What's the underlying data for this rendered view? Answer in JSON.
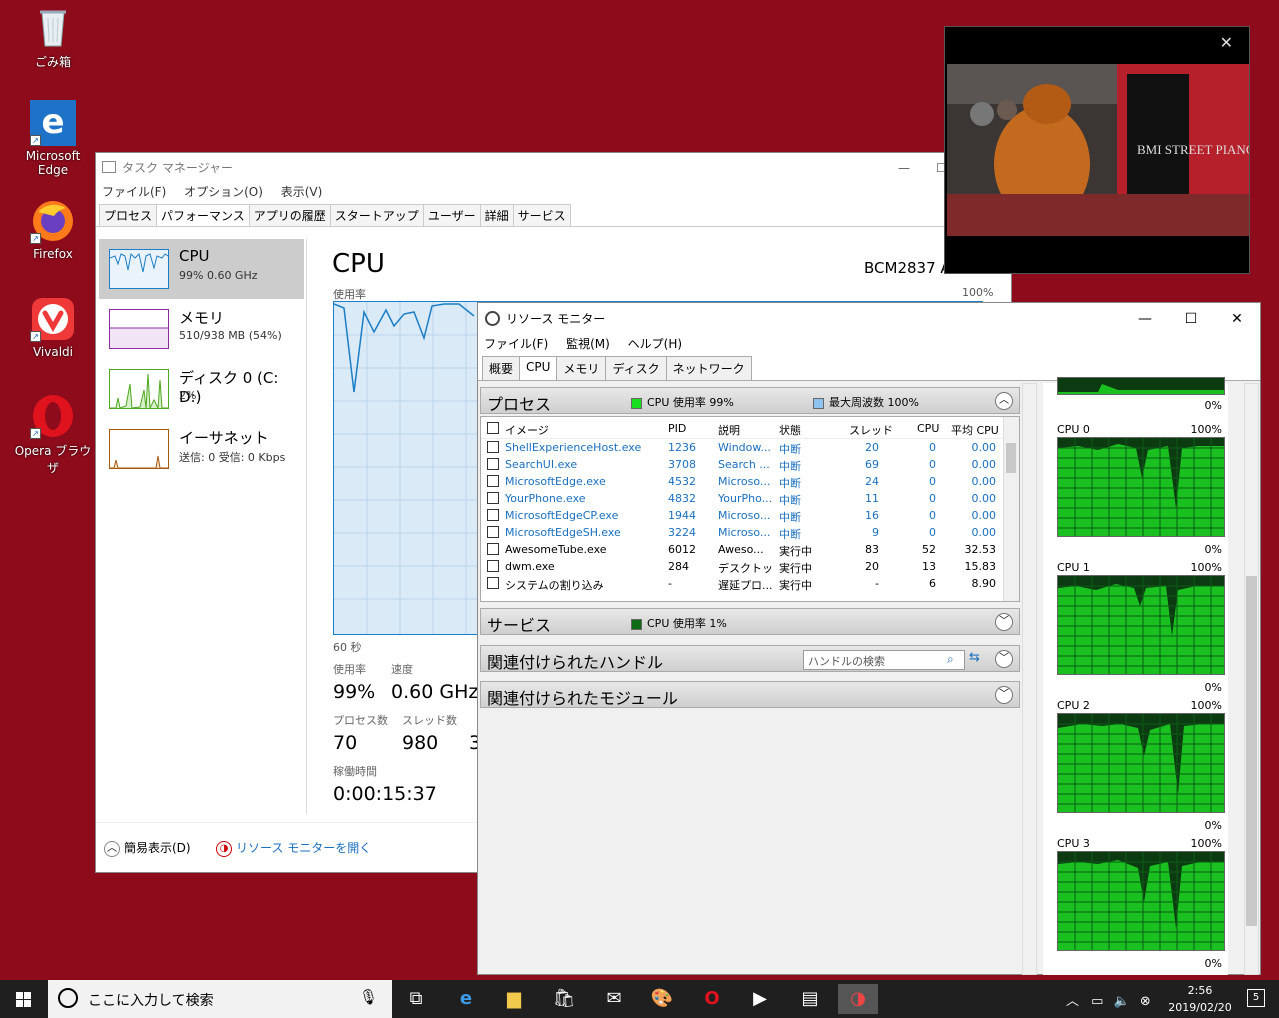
{
  "desktop": {
    "icons": [
      {
        "label": "ごみ箱",
        "icon": "recycle-bin-icon"
      },
      {
        "label": "Microsoft Edge",
        "icon": "edge-icon"
      },
      {
        "label": "Firefox",
        "icon": "firefox-icon"
      },
      {
        "label": "Vivaldi",
        "icon": "vivaldi-icon"
      },
      {
        "label": "Opera ブラウザ",
        "icon": "opera-icon"
      }
    ]
  },
  "task_manager": {
    "title": "タスク マネージャー",
    "menu": [
      "ファイル(F)",
      "オプション(O)",
      "表示(V)"
    ],
    "tabs": [
      "プロセス",
      "パフォーマンス",
      "アプリの履歴",
      "スタートアップ",
      "ユーザー",
      "詳細",
      "サービス"
    ],
    "active_tab": "パフォーマンス",
    "side": [
      {
        "name": "CPU",
        "sub": "99%  0.60 GHz"
      },
      {
        "name": "メモリ",
        "sub": "510/938 MB (54%)"
      },
      {
        "name": "ディスク 0 (C: D:)",
        "sub": "2%"
      },
      {
        "name": "イーサネット",
        "sub": "送信: 0 受信: 0 Kbps"
      }
    ],
    "header": "CPU",
    "model": "BCM2837 A",
    "usage_label": "使用率",
    "pct_label": "100%",
    "time_label": "60 秒",
    "stats": {
      "usage_label": "使用率",
      "usage_value": "99%",
      "speed_label": "速度",
      "speed_value": "0.60 GHz",
      "proc_label": "プロセス数",
      "proc_value": "70",
      "thread_label": "スレッド数",
      "thread_value": "980",
      "handle_value": "3",
      "uptime_label": "稼働時間",
      "uptime_value": "0:00:15:37"
    },
    "footer": {
      "simple": "簡易表示(D)",
      "resmon": "リソース モニターを開く"
    }
  },
  "resource_monitor": {
    "title": "リソース モニター",
    "menu": [
      "ファイル(F)",
      "監視(M)",
      "ヘルプ(H)"
    ],
    "tabs": [
      "概要",
      "CPU",
      "メモリ",
      "ディスク",
      "ネットワーク"
    ],
    "active_tab": "CPU",
    "process_section": {
      "label": "プロセス",
      "cpu_legend": "CPU 使用率 99%",
      "freq_legend": "最大周波数 100%",
      "columns": [
        "イメージ",
        "PID",
        "説明",
        "状態",
        "スレッド",
        "CPU",
        "平均 CPU"
      ],
      "rows": [
        {
          "image": "ShellExperienceHost.exe",
          "pid": "1236",
          "desc": "Window...",
          "state": "中断",
          "threads": "20",
          "cpu": "0",
          "avg": "0.00",
          "suspended": true
        },
        {
          "image": "SearchUI.exe",
          "pid": "3708",
          "desc": "Search ...",
          "state": "中断",
          "threads": "69",
          "cpu": "0",
          "avg": "0.00",
          "suspended": true
        },
        {
          "image": "MicrosoftEdge.exe",
          "pid": "4532",
          "desc": "Microso...",
          "state": "中断",
          "threads": "24",
          "cpu": "0",
          "avg": "0.00",
          "suspended": true
        },
        {
          "image": "YourPhone.exe",
          "pid": "4832",
          "desc": "YourPho...",
          "state": "中断",
          "threads": "11",
          "cpu": "0",
          "avg": "0.00",
          "suspended": true
        },
        {
          "image": "MicrosoftEdgeCP.exe",
          "pid": "1944",
          "desc": "Microso...",
          "state": "中断",
          "threads": "16",
          "cpu": "0",
          "avg": "0.00",
          "suspended": true
        },
        {
          "image": "MicrosoftEdgeSH.exe",
          "pid": "3224",
          "desc": "Microso...",
          "state": "中断",
          "threads": "9",
          "cpu": "0",
          "avg": "0.00",
          "suspended": true
        },
        {
          "image": "AwesomeTube.exe",
          "pid": "6012",
          "desc": "Aweso...",
          "state": "実行中",
          "threads": "83",
          "cpu": "52",
          "avg": "32.53",
          "suspended": false
        },
        {
          "image": "dwm.exe",
          "pid": "284",
          "desc": "デスクトッ...",
          "state": "実行中",
          "threads": "20",
          "cpu": "13",
          "avg": "15.83",
          "suspended": false
        },
        {
          "image": "システムの割り込み",
          "pid": "-",
          "desc": "遅延プロ...",
          "state": "実行中",
          "threads": "-",
          "cpu": "6",
          "avg": "8.90",
          "suspended": false
        }
      ]
    },
    "services_section": {
      "label": "サービス",
      "legend": "CPU 使用率 1%"
    },
    "handles_section": {
      "label": "関連付けられたハンドル",
      "search_placeholder": "ハンドルの検索"
    },
    "modules_section": {
      "label": "関連付けられたモジュール"
    },
    "cpu_graphs": [
      {
        "name": "CPU 0",
        "high": "100%",
        "low": "0%"
      },
      {
        "name": "CPU 1",
        "high": "100%",
        "low": "0%"
      },
      {
        "name": "CPU 2",
        "high": "100%",
        "low": "0%"
      },
      {
        "name": "CPU 3",
        "high": "100%",
        "low": "0%"
      }
    ],
    "top_graph_low": "0%"
  },
  "video": {
    "close": "✕",
    "sign_text": "BMI STREET PIANO"
  },
  "taskbar": {
    "search_placeholder": "ここに入力して検索",
    "time": "2:56",
    "date": "2019/02/20",
    "notifications": "5"
  },
  "colors": {
    "desktop": "#8d0b1b",
    "graph_green": "#19c020",
    "link_blue": "#1a6fc0"
  }
}
